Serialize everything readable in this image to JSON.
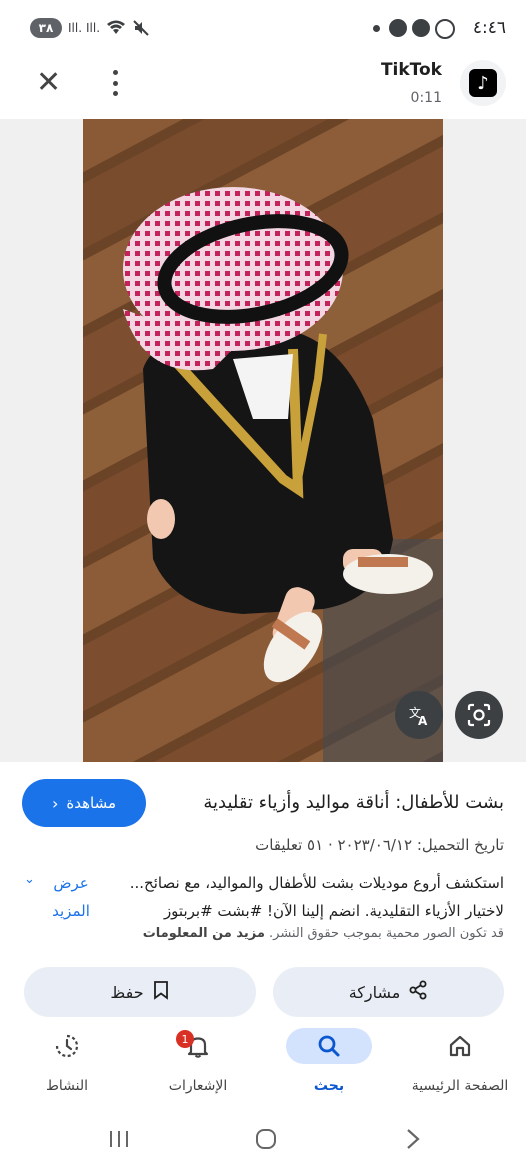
{
  "status_bar": {
    "time": "٤:٤٦",
    "battery": "٣٨",
    "signal_1": "Ill.",
    "signal_2": "Ill."
  },
  "header": {
    "app_name": "TikTok",
    "duration": "0:11",
    "app_icon_glyph": "♪"
  },
  "result": {
    "title": "بشت للأطفال: أناقة مواليد وأزياء تقليدية",
    "visit_label": "مشاهدة",
    "meta": "تاريخ التحميل: ٢٠٢٣/٠٦/١٢ · ٥١ تعليقات",
    "description": "استكشف أروع موديلات بشت للأطفال والمواليد، مع نصائح... لاختيار الأزياء التقليدية. انضم إلينا الآن! #بشت #بربتوز",
    "more_label": "عرض المزيد",
    "copyright_text": "قد تكون الصور محمية بموجب حقوق النشر.",
    "copyright_link": "مزيد من المعلومات"
  },
  "actions": {
    "share": "مشاركة",
    "save": "حفظ"
  },
  "nav": {
    "home": "الصفحة الرئيسية",
    "search": "بحث",
    "notifications": "الإشعارات",
    "notifications_badge": "1",
    "activity": "النشاط"
  },
  "colors": {
    "accent": "#1a73e8",
    "pill_bg": "#e9eef6",
    "badge": "#d93025"
  }
}
